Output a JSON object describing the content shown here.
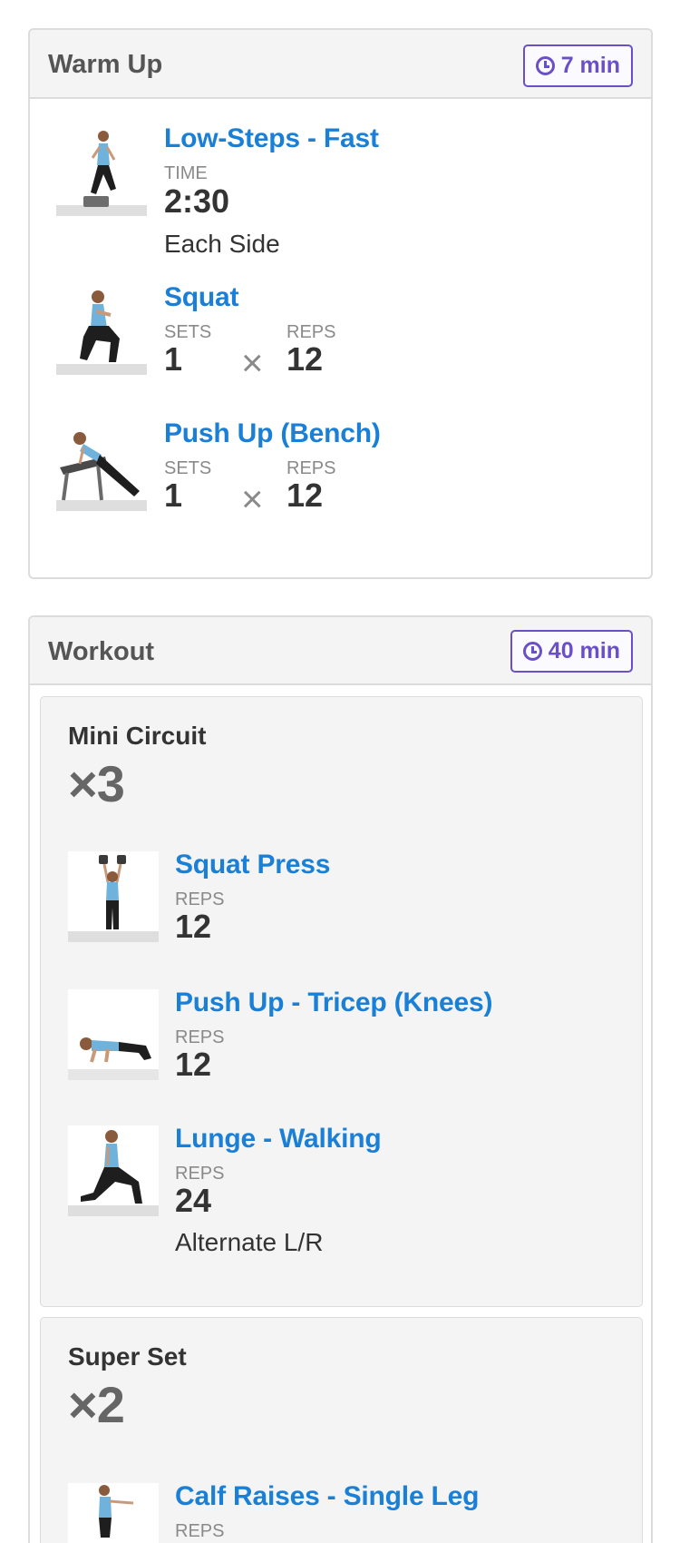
{
  "warmup": {
    "title": "Warm Up",
    "duration": "7 min",
    "exercises": [
      {
        "name": "Low-Steps - Fast",
        "time_label": "TIME",
        "time_value": "2:30",
        "note": "Each Side"
      },
      {
        "name": "Squat",
        "sets_label": "SETS",
        "sets_value": "1",
        "reps_label": "REPS",
        "reps_value": "12"
      },
      {
        "name": "Push Up (Bench)",
        "sets_label": "SETS",
        "sets_value": "1",
        "reps_label": "REPS",
        "reps_value": "12"
      }
    ]
  },
  "workout": {
    "title": "Workout",
    "duration": "40 min",
    "groups": [
      {
        "title": "Mini Circuit",
        "multiplier": "×3",
        "exercises": [
          {
            "name": "Squat Press",
            "reps_label": "REPS",
            "reps_value": "12"
          },
          {
            "name": "Push Up - Tricep (Knees)",
            "reps_label": "REPS",
            "reps_value": "12"
          },
          {
            "name": "Lunge - Walking",
            "reps_label": "REPS",
            "reps_value": "24",
            "note": "Alternate L/R"
          }
        ]
      },
      {
        "title": "Super Set",
        "multiplier": "×2",
        "exercises": [
          {
            "name": "Calf Raises - Single Leg",
            "reps_label": "REPS"
          }
        ]
      }
    ]
  },
  "icons": {
    "timer": "clock-icon",
    "multiply": "times-icon"
  },
  "colors": {
    "link": "#1a7fd6",
    "timer_badge": "#6b4fc9",
    "panel_header_bg": "#f4f4f4"
  }
}
